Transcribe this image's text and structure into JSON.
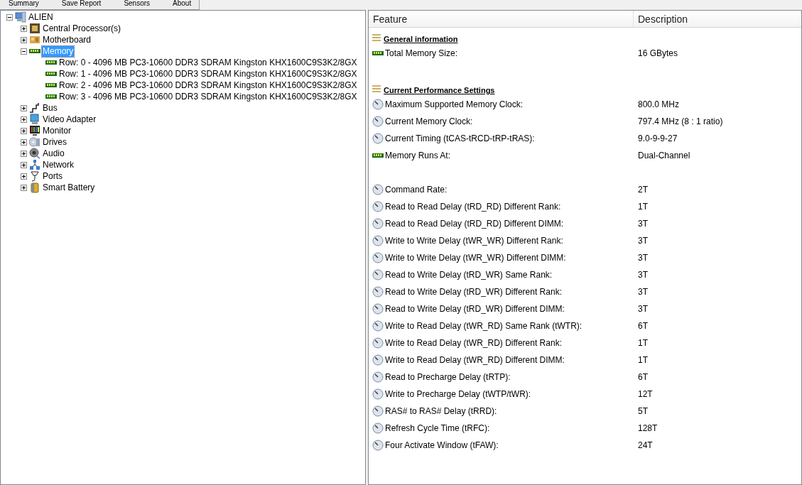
{
  "menu": [
    {
      "label": "Summary"
    },
    {
      "label": "Save Report"
    },
    {
      "label": "Sensors"
    },
    {
      "label": "About"
    }
  ],
  "tree": [
    {
      "label": "ALIEN",
      "kind": "computer",
      "expanded": true,
      "selected": false,
      "children": [
        {
          "label": "Central Processor(s)",
          "kind": "cpu",
          "expanded": false,
          "selected": false
        },
        {
          "label": "Motherboard",
          "kind": "board",
          "expanded": false,
          "selected": false
        },
        {
          "label": "Memory",
          "kind": "ram",
          "expanded": true,
          "selected": true,
          "children": [
            {
              "label": "Row: 0 - 4096 MB PC3-10600 DDR3 SDRAM Kingston KHX1600C9S3K2/8GX",
              "kind": "ram",
              "selected": false
            },
            {
              "label": "Row: 1 - 4096 MB PC3-10600 DDR3 SDRAM Kingston KHX1600C9S3K2/8GX",
              "kind": "ram",
              "selected": false
            },
            {
              "label": "Row: 2 - 4096 MB PC3-10600 DDR3 SDRAM Kingston KHX1600C9S3K2/8GX",
              "kind": "ram",
              "selected": false
            },
            {
              "label": "Row: 3 - 4096 MB PC3-10600 DDR3 SDRAM Kingston KHX1600C9S3K2/8GX",
              "kind": "ram",
              "selected": false
            }
          ]
        },
        {
          "label": "Bus",
          "kind": "bus",
          "expanded": false,
          "selected": false
        },
        {
          "label": "Video Adapter",
          "kind": "video",
          "expanded": false,
          "selected": false
        },
        {
          "label": "Monitor",
          "kind": "monitor",
          "expanded": false,
          "selected": false
        },
        {
          "label": "Drives",
          "kind": "drives",
          "expanded": false,
          "selected": false
        },
        {
          "label": "Audio",
          "kind": "audio",
          "expanded": false,
          "selected": false
        },
        {
          "label": "Network",
          "kind": "network",
          "expanded": false,
          "selected": false
        },
        {
          "label": "Ports",
          "kind": "ports",
          "expanded": false,
          "selected": false
        },
        {
          "label": "Smart Battery",
          "kind": "battery",
          "expanded": false,
          "selected": false
        }
      ]
    }
  ],
  "table": {
    "columns": [
      "Feature",
      "Description"
    ],
    "rows": [
      {
        "kind": "heading",
        "feature": "General information"
      },
      {
        "kind": "ram",
        "feature": "Total Memory Size:",
        "description": "16 GBytes"
      },
      {
        "kind": "blank"
      },
      {
        "kind": "heading",
        "feature": "Current Performance Settings"
      },
      {
        "kind": "clock",
        "feature": "Maximum Supported Memory Clock:",
        "description": "800.0 MHz"
      },
      {
        "kind": "clock",
        "feature": "Current Memory Clock:",
        "description": "797.4 MHz (8 : 1 ratio)"
      },
      {
        "kind": "clock",
        "feature": "Current Timing (tCAS-tRCD-tRP-tRAS):",
        "description": "9.0-9-9-27"
      },
      {
        "kind": "ram",
        "feature": "Memory Runs At:",
        "description": "Dual-Channel"
      },
      {
        "kind": "blank"
      },
      {
        "kind": "clock",
        "feature": "Command Rate:",
        "description": "2T"
      },
      {
        "kind": "clock",
        "feature": "Read to Read Delay (tRD_RD) Different Rank:",
        "description": "1T"
      },
      {
        "kind": "clock",
        "feature": "Read to Read Delay (tRD_RD) Different DIMM:",
        "description": "3T"
      },
      {
        "kind": "clock",
        "feature": "Write to Write Delay (tWR_WR) Different Rank:",
        "description": "3T"
      },
      {
        "kind": "clock",
        "feature": "Write to Write Delay (tWR_WR) Different DIMM:",
        "description": "3T"
      },
      {
        "kind": "clock",
        "feature": "Read to Write Delay (tRD_WR) Same Rank:",
        "description": "3T"
      },
      {
        "kind": "clock",
        "feature": "Read to Write Delay (tRD_WR) Different Rank:",
        "description": "3T"
      },
      {
        "kind": "clock",
        "feature": "Read to Write Delay (tRD_WR) Different DIMM:",
        "description": "3T"
      },
      {
        "kind": "clock",
        "feature": "Write to Read Delay (tWR_RD) Same Rank (tWTR):",
        "description": "6T"
      },
      {
        "kind": "clock",
        "feature": "Write to Read Delay (tWR_RD) Different Rank:",
        "description": "1T"
      },
      {
        "kind": "clock",
        "feature": "Write to Read Delay (tWR_RD) Different DIMM:",
        "description": "1T"
      },
      {
        "kind": "clock",
        "feature": "Read to Precharge Delay (tRTP):",
        "description": "6T"
      },
      {
        "kind": "clock",
        "feature": "Write to Precharge Delay (tWTP/tWR):",
        "description": "12T"
      },
      {
        "kind": "clock",
        "feature": "RAS# to RAS# Delay (tRRD):",
        "description": "5T"
      },
      {
        "kind": "clock",
        "feature": "Refresh Cycle Time (tRFC):",
        "description": "128T"
      },
      {
        "kind": "clock",
        "feature": "Four Activate Window (tFAW):",
        "description": "24T"
      }
    ]
  }
}
